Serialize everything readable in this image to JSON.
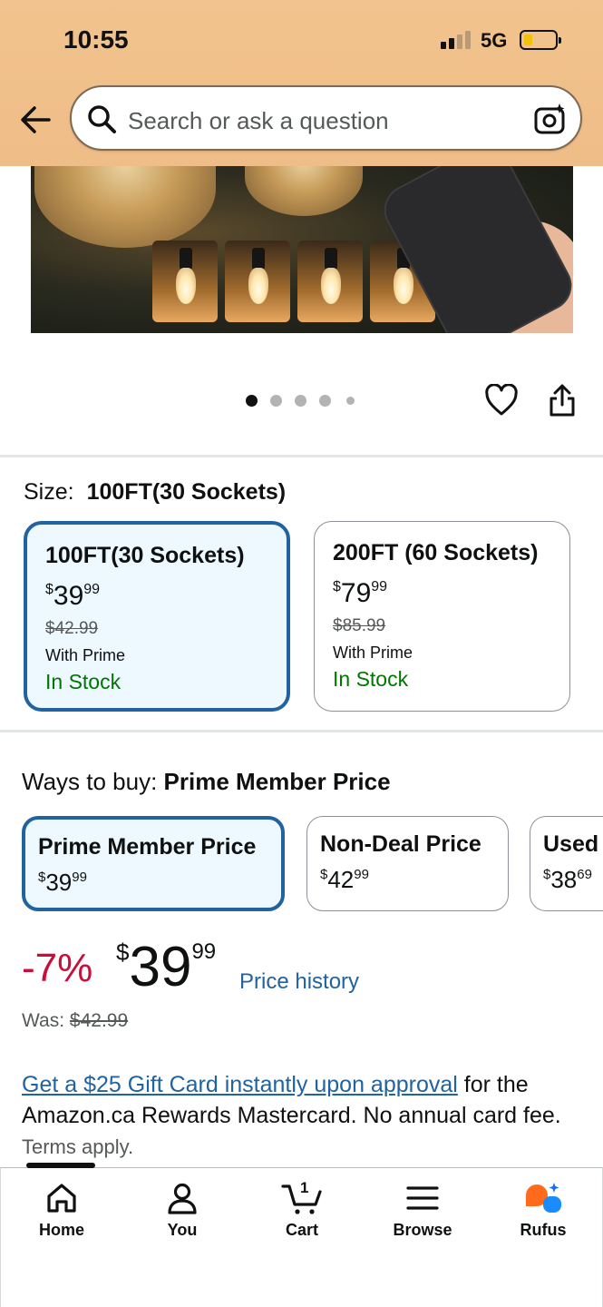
{
  "status_bar": {
    "time": "10:55",
    "network": "5G"
  },
  "search": {
    "placeholder": "Search or ask a question"
  },
  "size": {
    "label": "Size:",
    "selected": "100FT(30 Sockets)",
    "options": [
      {
        "title": "100FT(30 Sockets)",
        "currency": "$",
        "dollars": "39",
        "cents": "99",
        "was": "$42.99",
        "prime": "With Prime",
        "stock": "In Stock"
      },
      {
        "title": "200FT (60 Sockets)",
        "currency": "$",
        "dollars": "79",
        "cents": "99",
        "was": "$85.99",
        "prime": "With Prime",
        "stock": "In Stock"
      }
    ]
  },
  "ways_to_buy": {
    "label": "Ways to buy:",
    "selected": "Prime Member Price",
    "options": [
      {
        "title": "Prime Member Price",
        "currency": "$",
        "dollars": "39",
        "cents": "99"
      },
      {
        "title": "Non-Deal Price",
        "currency": "$",
        "dollars": "42",
        "cents": "99"
      },
      {
        "title": "Used",
        "currency": "$",
        "dollars": "38",
        "cents": "69"
      }
    ]
  },
  "price": {
    "discount": "-7%",
    "currency": "$",
    "dollars": "39",
    "cents": "99",
    "history_link": "Price history",
    "was_label": "Was:",
    "was_value": "$42.99"
  },
  "promo": {
    "link": "Get a $25 Gift Card instantly upon approval",
    "text": " for the Amazon.ca Rewards Mastercard. No annual card fee.",
    "terms": "Terms apply."
  },
  "bottom_nav": {
    "items": [
      {
        "label": "Home",
        "icon": "home-icon"
      },
      {
        "label": "You",
        "icon": "person-icon"
      },
      {
        "label": "Cart",
        "icon": "cart-icon",
        "count": "1"
      },
      {
        "label": "Browse",
        "icon": "menu-icon"
      },
      {
        "label": "Rufus",
        "icon": "rufus-icon"
      }
    ]
  },
  "colors": {
    "header": "#efbd87",
    "link": "#2162a1",
    "selected_border": "#2162a1",
    "selected_bg": "#edf8ff",
    "discount": "#cc0c39",
    "in_stock": "#007600",
    "rufus_orange": "#ff6b1a",
    "rufus_blue": "#1a8cff"
  },
  "carousel": {
    "total": 5,
    "active": 0
  }
}
